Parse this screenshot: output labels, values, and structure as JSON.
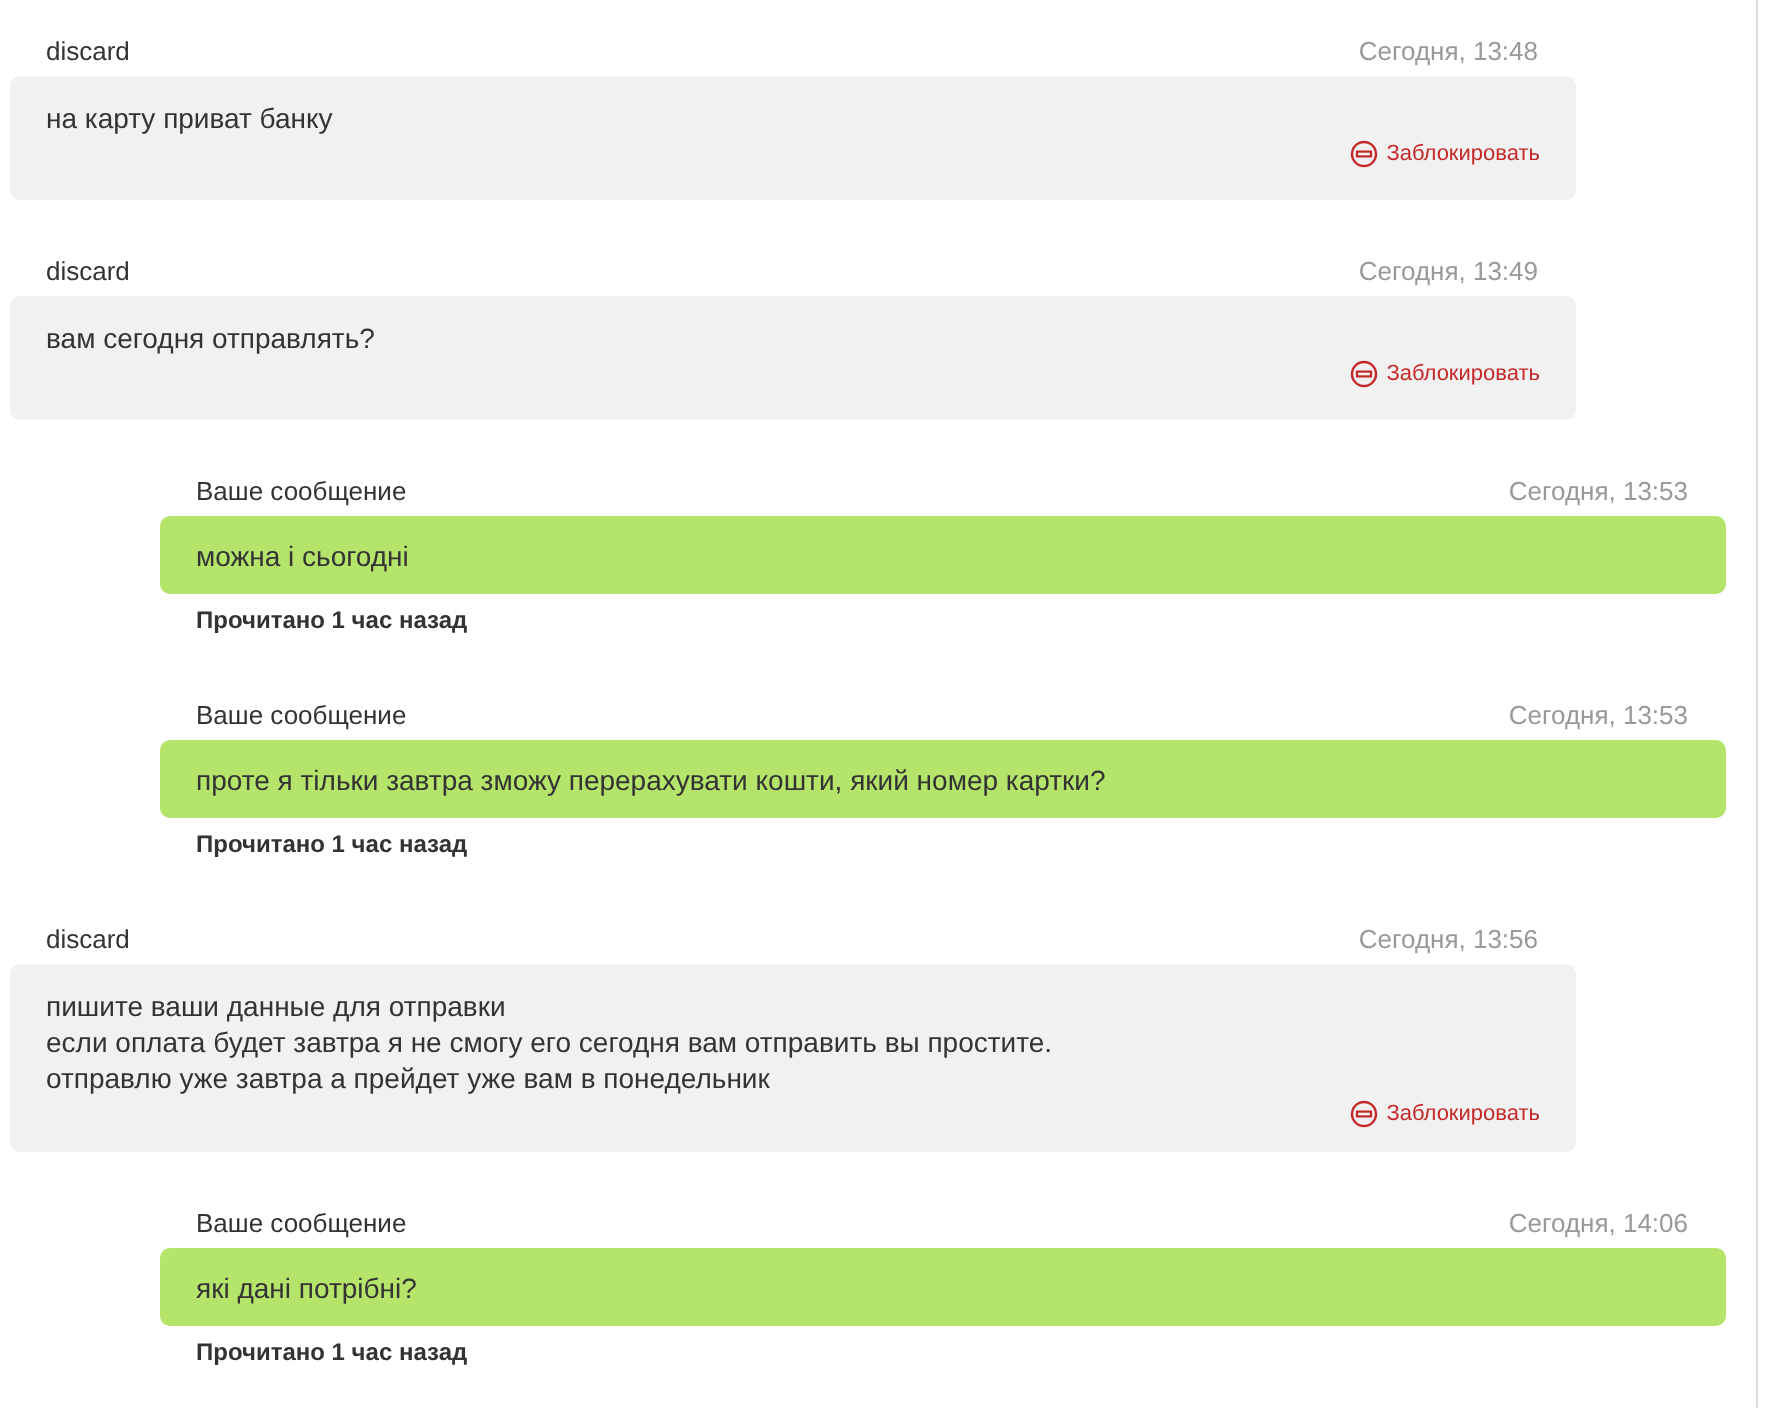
{
  "messages": [
    {
      "kind": "incoming",
      "author": "discard",
      "time": "Сегодня, 13:48",
      "lines": [
        "на карту приват банку"
      ],
      "block_label": "Заблокировать"
    },
    {
      "kind": "incoming",
      "author": "discard",
      "time": "Сегодня, 13:49",
      "lines": [
        "вам сегодня отправлять?"
      ],
      "block_label": "Заблокировать"
    },
    {
      "kind": "outgoing",
      "author": "Ваше сообщение",
      "time": "Сегодня, 13:53",
      "lines": [
        "можна і сьогодні"
      ],
      "status": "Прочитано 1 час назад"
    },
    {
      "kind": "outgoing",
      "author": "Ваше сообщение",
      "time": "Сегодня, 13:53",
      "lines": [
        "проте я тільки завтра зможу перерахувати кошти, який номер картки?"
      ],
      "status": "Прочитано 1 час назад"
    },
    {
      "kind": "incoming",
      "author": "discard",
      "time": "Сегодня, 13:56",
      "lines": [
        "пишите ваши данные для отправки",
        "если оплата будет завтра я не смогу его сегодня вам отправить вы простите.",
        "отправлю уже завтра а прейдет уже вам в понедельник"
      ],
      "block_label": "Заблокировать"
    },
    {
      "kind": "outgoing",
      "author": "Ваше сообщение",
      "time": "Сегодня, 14:06",
      "lines": [
        "які дані потрібні?"
      ],
      "status": "Прочитано 1 час назад"
    }
  ]
}
